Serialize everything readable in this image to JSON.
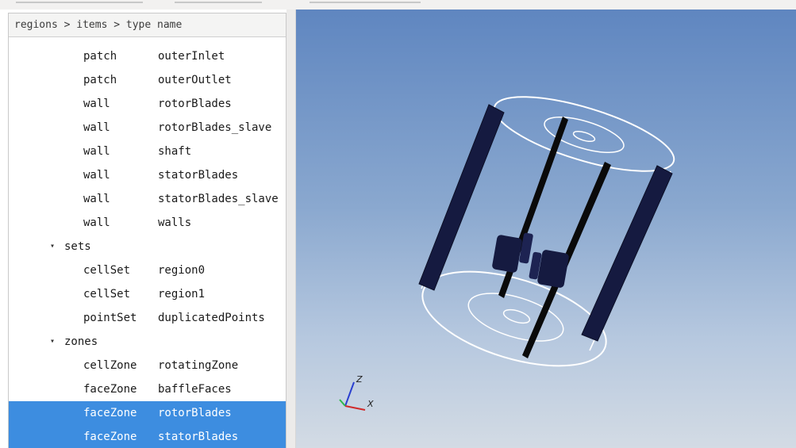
{
  "tree": {
    "header": "regions > items > type name",
    "rows": [
      {
        "kind": "item",
        "type": "patch",
        "name": "outerInlet",
        "selected": false
      },
      {
        "kind": "item",
        "type": "patch",
        "name": "outerOutlet",
        "selected": false
      },
      {
        "kind": "item",
        "type": "wall",
        "name": "rotorBlades",
        "selected": false
      },
      {
        "kind": "item",
        "type": "wall",
        "name": "rotorBlades_slave",
        "selected": false
      },
      {
        "kind": "item",
        "type": "wall",
        "name": "shaft",
        "selected": false
      },
      {
        "kind": "item",
        "type": "wall",
        "name": "statorBlades",
        "selected": false
      },
      {
        "kind": "item",
        "type": "wall",
        "name": "statorBlades_slave",
        "selected": false
      },
      {
        "kind": "item",
        "type": "wall",
        "name": "walls",
        "selected": false
      },
      {
        "kind": "group",
        "label": "sets",
        "expanded": true
      },
      {
        "kind": "item",
        "type": "cellSet",
        "name": "region0",
        "selected": false
      },
      {
        "kind": "item",
        "type": "cellSet",
        "name": "region1",
        "selected": false
      },
      {
        "kind": "item",
        "type": "pointSet",
        "name": "duplicatedPoints",
        "selected": false
      },
      {
        "kind": "group",
        "label": "zones",
        "expanded": true
      },
      {
        "kind": "item",
        "type": "cellZone",
        "name": "rotatingZone",
        "selected": false
      },
      {
        "kind": "item",
        "type": "faceZone",
        "name": "baffleFaces",
        "selected": false
      },
      {
        "kind": "item",
        "type": "faceZone",
        "name": "rotorBlades",
        "selected": true
      },
      {
        "kind": "item",
        "type": "faceZone",
        "name": "statorBlades",
        "selected": true
      }
    ]
  },
  "viewport": {
    "axes": {
      "z_label": "Z",
      "x_label": "X"
    },
    "colors": {
      "selection": "#3d8de0",
      "blade": "#151a40",
      "outline": "#ffffff",
      "axis_z": "#2a3fd0",
      "axis_x": "#d02a2a",
      "axis_y": "#2fb84a"
    }
  },
  "icons": {
    "expanded": "▾"
  }
}
